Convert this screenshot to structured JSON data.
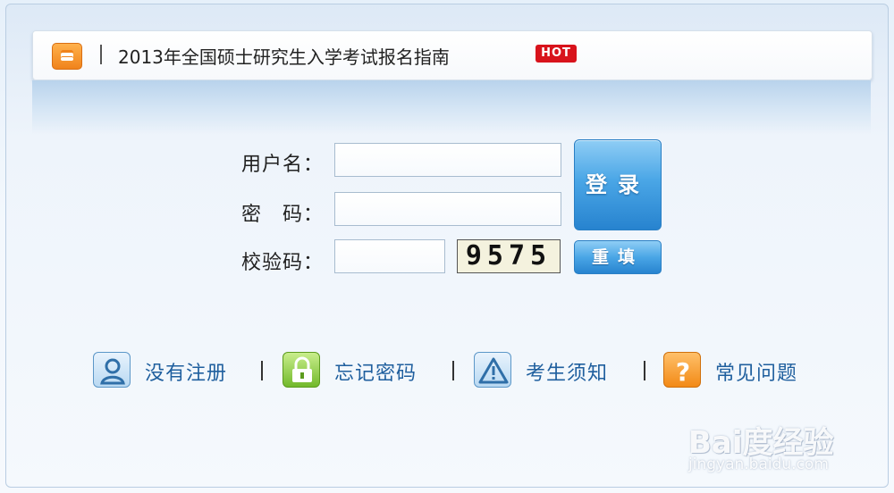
{
  "notice": {
    "text": "2013年全国硕士研究生入学考试报名指南",
    "badge": "HOT",
    "icon": "notice-document-icon"
  },
  "login_form": {
    "username_label": "用户名：",
    "password_label": "密　码：",
    "captcha_label": "校验码：",
    "username_value": "",
    "password_value": "",
    "captcha_value": "",
    "captcha_image_text": "9575",
    "login_button": "登录",
    "reset_button": "重填"
  },
  "links": [
    {
      "label": "没有注册",
      "icon": "user-icon"
    },
    {
      "label": "忘记密码",
      "icon": "lock-icon"
    },
    {
      "label": "考生须知",
      "icon": "warning-icon"
    },
    {
      "label": "常见问题",
      "icon": "question-icon"
    }
  ],
  "watermark": {
    "main": "Bai度经验",
    "sub": "jingyan.baidu.com"
  },
  "colors": {
    "accent_blue": "#3d9ce0",
    "link_blue": "#1f5f9e",
    "hot_red": "#d8131c",
    "notice_orange": "#f0831c"
  }
}
